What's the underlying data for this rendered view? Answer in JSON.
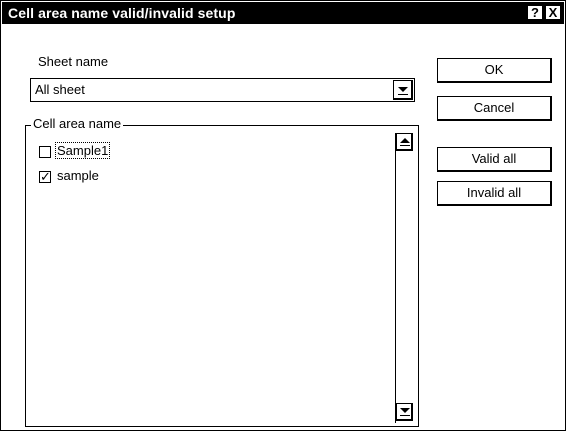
{
  "dialog": {
    "title": "Cell area name valid/invalid setup",
    "help_button": "?",
    "close_button": "X"
  },
  "sheet": {
    "label": "Sheet name",
    "selected": "All sheet"
  },
  "cell_area": {
    "group_label": "Cell area name",
    "items": [
      {
        "label": "Sample1",
        "checked": false
      },
      {
        "label": "sample",
        "checked": true
      }
    ]
  },
  "buttons": {
    "ok": "OK",
    "cancel": "Cancel",
    "valid_all": "Valid all",
    "invalid_all": "Invalid all"
  }
}
